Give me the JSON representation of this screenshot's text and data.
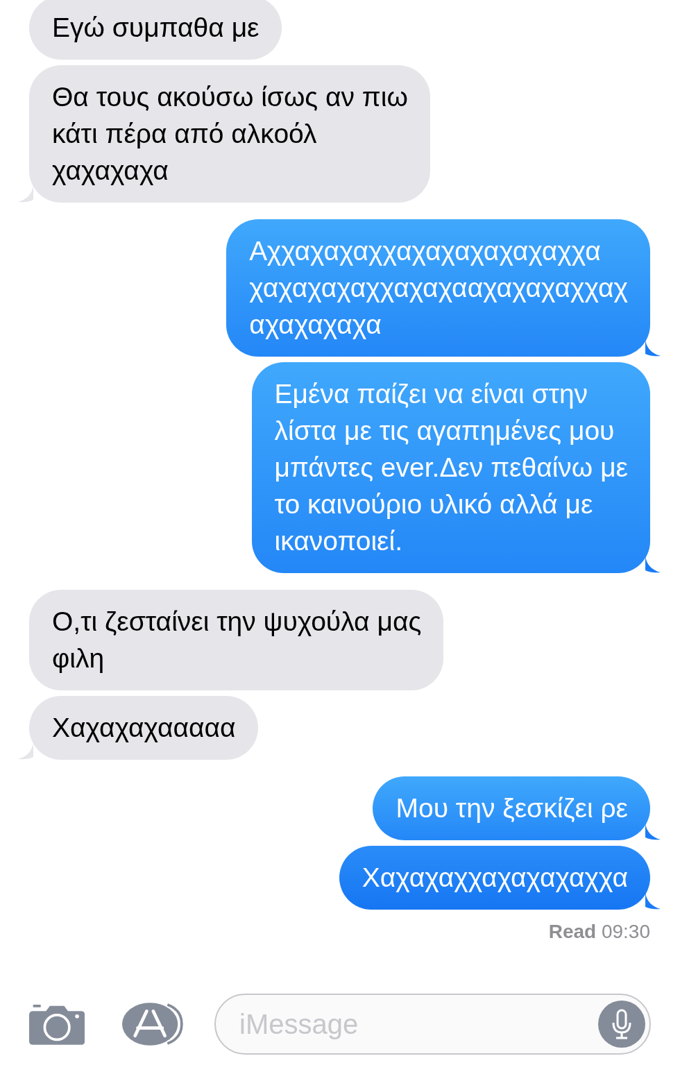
{
  "messages": [
    {
      "kind": "received",
      "text": "Εγώ συμπαθα με",
      "tail": false
    },
    {
      "kind": "received",
      "text": "Θα τους ακούσω ίσως αν πιω\nκάτι πέρα από αλκοόλ\nχαχαχαχα",
      "tail": true
    },
    {
      "kind": "sent",
      "text": "Αχχαχαχαχχαχαχαχαχαχαχχα\nχαχαχαχαχχαχαχααχαχαχαχχαχ\nαχαχαχαχα",
      "tail": true
    },
    {
      "kind": "sent",
      "text": "Εμένα παίζει να είναι στην\nλίστα με τις αγαπημένες μου\nμπάντες ever.Δεν πεθαίνω με\nτο καινούριο υλικό αλλά με\nικανοποιεί.",
      "tail": true
    },
    {
      "kind": "received",
      "text": "Ο,τι ζεσταίνει την ψυχούλα μας\nφιλη",
      "tail": false
    },
    {
      "kind": "received",
      "text": "Χαχαχαχααααα",
      "tail": true
    },
    {
      "kind": "sent",
      "text": "Μου την ξεσκίζει ρε",
      "tail": true
    },
    {
      "kind": "sent",
      "text": "Χαχαχαχχαχαχαχαχχα",
      "tail": true
    }
  ],
  "read_receipt": "**Read** 09:30",
  "input": {
    "placeholder": "iMessage"
  }
}
